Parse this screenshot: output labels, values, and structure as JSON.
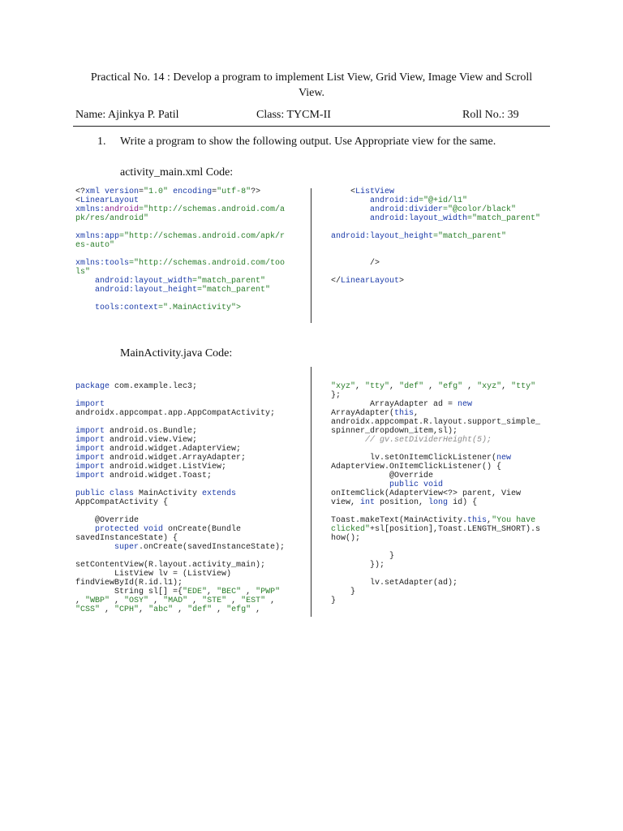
{
  "title": "Practical No. 14 : Develop a program to implement List View, Grid View, Image View and Scroll View.",
  "header": {
    "name": "Name: Ajinkya P. Patil",
    "class": "Class: TYCM-II",
    "roll": "Roll No.: 39"
  },
  "question": {
    "number": "1.",
    "text": "Write a program to show the following output. Use Appropriate view for the same."
  },
  "xml_label": "activity_main.xml Code:",
  "java_label": "MainActivity.java Code:",
  "xml_left": [
    [
      [
        "<?",
        "t"
      ],
      [
        "xml version",
        "k"
      ],
      [
        "=",
        "t"
      ],
      [
        "\"1.0\"",
        "s"
      ],
      [
        " encoding",
        "k"
      ],
      [
        "=",
        "t"
      ],
      [
        "\"utf-8\"",
        "s"
      ],
      [
        "?>",
        "t"
      ]
    ],
    [
      [
        "<",
        "t"
      ],
      [
        "LinearLayout",
        "k"
      ]
    ],
    [
      [
        "xmlns:",
        "k"
      ],
      [
        "android",
        "p"
      ],
      [
        "=\"http://schemas.android.com/a",
        "s"
      ]
    ],
    [
      [
        "pk/res/android\"",
        "s"
      ]
    ],
    [],
    [
      [
        "xmlns:app",
        "k"
      ],
      [
        "=\"http://schemas.android.com/apk/r",
        "s"
      ]
    ],
    [
      [
        "es-auto\"",
        "s"
      ]
    ],
    [],
    [
      [
        "xmlns:tools",
        "k"
      ],
      [
        "=\"http://schemas.android.com/too",
        "s"
      ]
    ],
    [
      [
        "ls\"",
        "s"
      ]
    ],
    [
      [
        "    android:layout_width",
        "k"
      ],
      [
        "=\"match_parent\"",
        "s"
      ]
    ],
    [
      [
        "    android:layout_height",
        "k"
      ],
      [
        "=\"match_parent\"",
        "s"
      ]
    ],
    [],
    [
      [
        "    tools:context",
        "k"
      ],
      [
        "=\".MainActivity\">",
        "s"
      ]
    ]
  ],
  "xml_right": [
    [
      [
        "    <",
        "t"
      ],
      [
        "ListView",
        "k"
      ]
    ],
    [
      [
        "        android:id",
        "k"
      ],
      [
        "=\"@+id/l1\"",
        "s"
      ]
    ],
    [
      [
        "        android:divider",
        "k"
      ],
      [
        "=\"@color/black\"",
        "s"
      ]
    ],
    [
      [
        "        android:layout_width",
        "k"
      ],
      [
        "=\"match_parent\"",
        "s"
      ]
    ],
    [],
    [
      [
        "android:layout_height",
        "k"
      ],
      [
        "=\"match_parent\"",
        "s"
      ]
    ],
    [],
    [],
    [
      [
        "        />",
        "t"
      ]
    ],
    [],
    [
      [
        "</",
        "t"
      ],
      [
        "LinearLayout",
        "k"
      ],
      [
        ">",
        "t"
      ]
    ]
  ],
  "java_left": [
    [
      [
        "package",
        "k"
      ],
      [
        " com.example.lec3;",
        "t"
      ]
    ],
    [],
    [
      [
        "import",
        "k"
      ]
    ],
    [
      [
        "androidx.appcompat.app.AppCompatActivity;",
        "t"
      ]
    ],
    [],
    [
      [
        "import",
        "k"
      ],
      [
        " android.os.Bundle;",
        "t"
      ]
    ],
    [
      [
        "import",
        "k"
      ],
      [
        " android.view.View;",
        "t"
      ]
    ],
    [
      [
        "import",
        "k"
      ],
      [
        " android.widget.AdapterView;",
        "t"
      ]
    ],
    [
      [
        "import",
        "k"
      ],
      [
        " android.widget.ArrayAdapter;",
        "t"
      ]
    ],
    [
      [
        "import",
        "k"
      ],
      [
        " android.widget.ListView;",
        "t"
      ]
    ],
    [
      [
        "import",
        "k"
      ],
      [
        " android.widget.Toast;",
        "t"
      ]
    ],
    [],
    [
      [
        "public class",
        "k"
      ],
      [
        " MainActivity ",
        "t"
      ],
      [
        "extends",
        "k"
      ]
    ],
    [
      [
        "AppCompatActivity {",
        "t"
      ]
    ],
    [],
    [
      [
        "    @Override",
        "t"
      ]
    ],
    [
      [
        "    protected void",
        "k"
      ],
      [
        " onCreate(Bundle",
        "t"
      ]
    ],
    [
      [
        "savedInstanceState) {",
        "t"
      ]
    ],
    [
      [
        "        super",
        "k"
      ],
      [
        ".onCreate(savedInstanceState);",
        "t"
      ]
    ],
    [],
    [
      [
        "setContentView(R.layout.activity_main);",
        "t"
      ]
    ],
    [
      [
        "        ListView lv = (ListView)",
        "t"
      ]
    ],
    [
      [
        "findViewById(R.id.l1);",
        "t"
      ]
    ],
    [
      [
        "        String sl[] ={",
        "t"
      ],
      [
        "\"EDE\"",
        "s"
      ],
      [
        ", ",
        "t"
      ],
      [
        "\"BEC\"",
        "s"
      ],
      [
        " , ",
        "t"
      ],
      [
        "\"PWP\"",
        "s"
      ]
    ],
    [
      [
        ", ",
        "t"
      ],
      [
        "\"WBP\"",
        "s"
      ],
      [
        " , ",
        "t"
      ],
      [
        "\"OSY\"",
        "s"
      ],
      [
        " , ",
        "t"
      ],
      [
        "\"MAD\"",
        "s"
      ],
      [
        " , ",
        "t"
      ],
      [
        "\"STE\"",
        "s"
      ],
      [
        " , ",
        "t"
      ],
      [
        "\"EST\"",
        "s"
      ],
      [
        " ,",
        "t"
      ]
    ],
    [
      [
        "\"CSS\"",
        "s"
      ],
      [
        " , ",
        "t"
      ],
      [
        "\"CPH\"",
        "s"
      ],
      [
        ", ",
        "t"
      ],
      [
        "\"abc\"",
        "s"
      ],
      [
        " , ",
        "t"
      ],
      [
        "\"def\"",
        "s"
      ],
      [
        " , ",
        "t"
      ],
      [
        "\"efg\"",
        "s"
      ],
      [
        " ,",
        "t"
      ]
    ]
  ],
  "java_right": [
    [
      [
        "\"xyz\"",
        "s"
      ],
      [
        ", ",
        "t"
      ],
      [
        "\"tty\"",
        "s"
      ],
      [
        ", ",
        "t"
      ],
      [
        "\"def\"",
        "s"
      ],
      [
        " , ",
        "t"
      ],
      [
        "\"efg\"",
        "s"
      ],
      [
        " , ",
        "t"
      ],
      [
        "\"xyz\"",
        "s"
      ],
      [
        ", ",
        "t"
      ],
      [
        "\"tty\"",
        "s"
      ]
    ],
    [
      [
        "};",
        "t"
      ]
    ],
    [
      [
        "        ArrayAdapter ad = ",
        "t"
      ],
      [
        "new",
        "k"
      ]
    ],
    [
      [
        "ArrayAdapter(",
        "t"
      ],
      [
        "this",
        "k"
      ],
      [
        ",",
        "t"
      ]
    ],
    [
      [
        "androidx.appcompat.R.layout.support_simple_",
        "t"
      ]
    ],
    [
      [
        "spinner_dropdown_item,sl);",
        "t"
      ]
    ],
    [
      [
        "       // gv.setDividerHeight(5);",
        "c"
      ]
    ],
    [],
    [
      [
        "        lv.setOnItemClickListener(",
        "t"
      ],
      [
        "new",
        "k"
      ]
    ],
    [
      [
        "AdapterView.OnItemClickListener() {",
        "t"
      ]
    ],
    [
      [
        "            @Override",
        "t"
      ]
    ],
    [
      [
        "            public void",
        "k"
      ]
    ],
    [
      [
        "onItemClick(AdapterView<?> parent, View",
        "t"
      ]
    ],
    [
      [
        "view, ",
        "t"
      ],
      [
        "int",
        "k"
      ],
      [
        " position, ",
        "t"
      ],
      [
        "long",
        "k"
      ],
      [
        " id) {",
        "t"
      ]
    ],
    [],
    [
      [
        "Toast.makeText(MainActivity.",
        "t"
      ],
      [
        "this",
        "k"
      ],
      [
        ",",
        "t"
      ],
      [
        "\"You have",
        "s"
      ]
    ],
    [
      [
        "clicked\"",
        "s"
      ],
      [
        "+sl[position],Toast.LENGTH_SHORT).s",
        "t"
      ]
    ],
    [
      [
        "how();",
        "t"
      ]
    ],
    [],
    [
      [
        "            }",
        "t"
      ]
    ],
    [
      [
        "        });",
        "t"
      ]
    ],
    [],
    [
      [
        "        lv.setAdapter(ad);",
        "t"
      ]
    ],
    [
      [
        "    }",
        "t"
      ]
    ],
    [
      [
        "}",
        "t"
      ]
    ]
  ]
}
